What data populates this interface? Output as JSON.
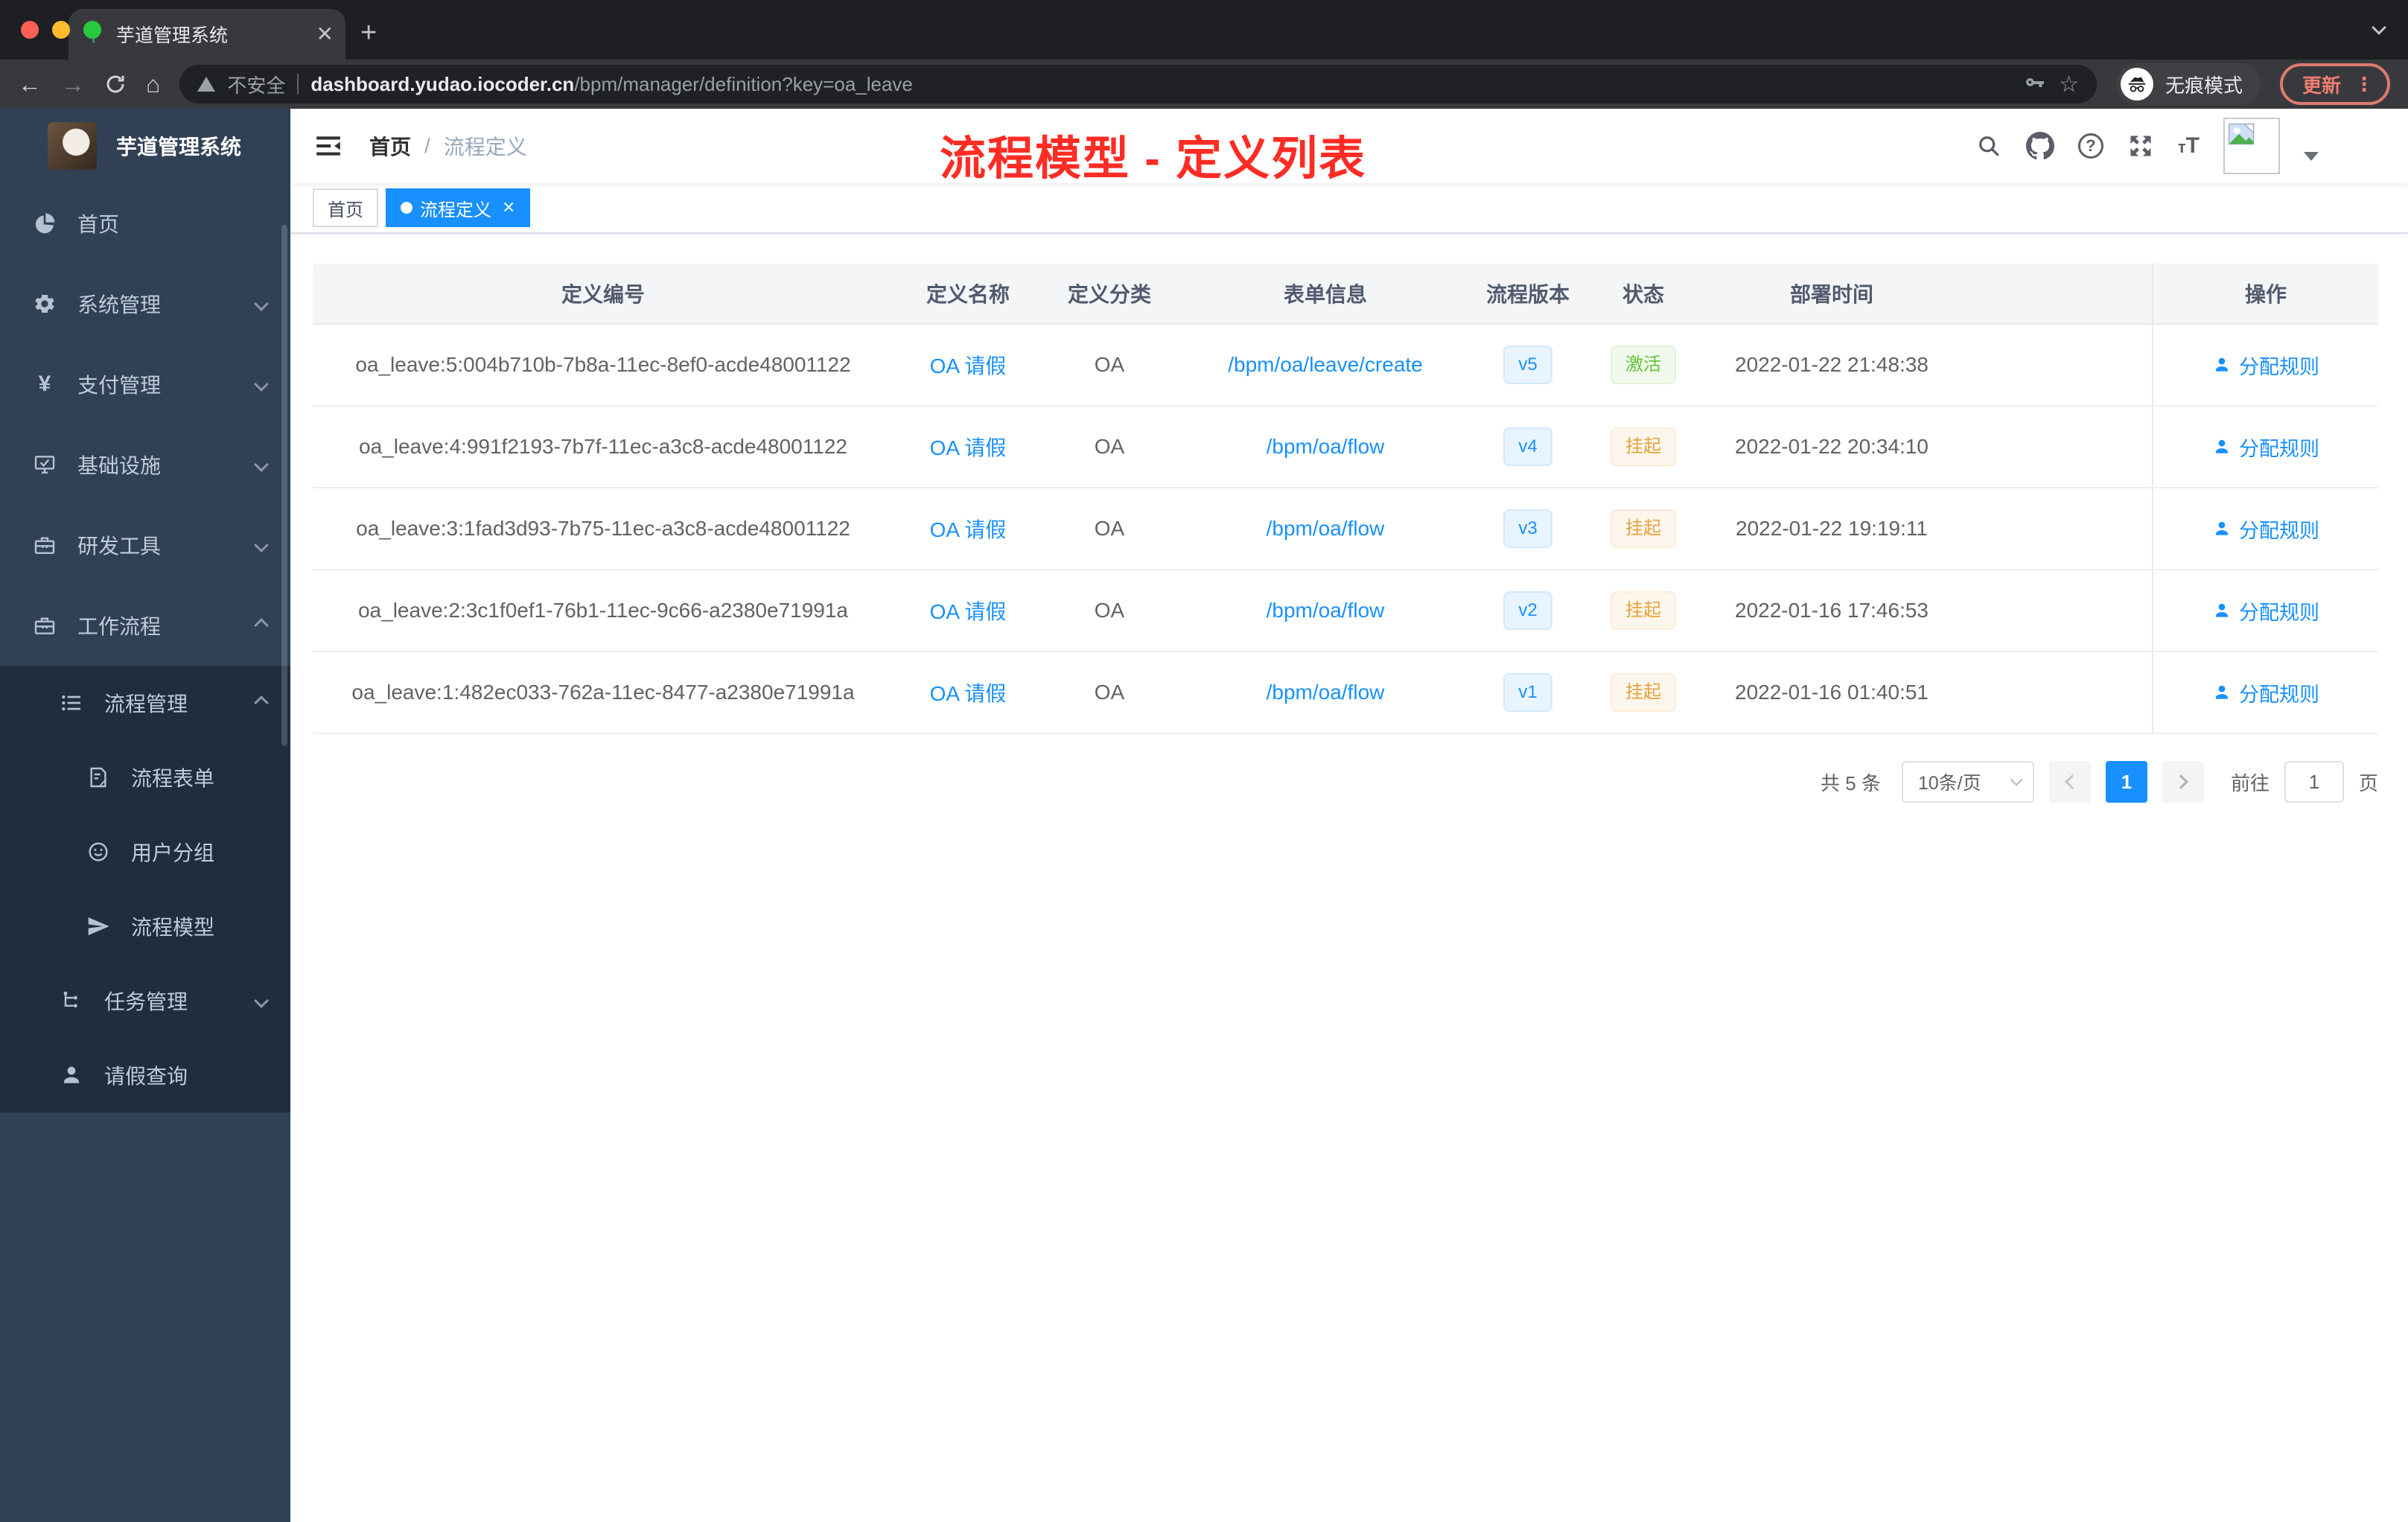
{
  "colors": {
    "accent": "#1890ff",
    "success": "#67c23a",
    "warning": "#e6a23c",
    "annotation_red": "#fe2c25"
  },
  "browser": {
    "tab_title": "芋道管理系统",
    "security_label": "不安全",
    "url_host": "dashboard.yudao.iocoder.cn",
    "url_path": "/bpm/manager/definition?key=oa_leave",
    "incognito_label": "无痕模式",
    "update_label": "更新"
  },
  "sidebar": {
    "app_title": "芋道管理系统",
    "items": [
      {
        "label": "首页"
      },
      {
        "label": "系统管理"
      },
      {
        "label": "支付管理"
      },
      {
        "label": "基础设施"
      },
      {
        "label": "研发工具"
      },
      {
        "label": "工作流程"
      },
      {
        "label": "流程管理"
      },
      {
        "label": "流程表单"
      },
      {
        "label": "用户分组"
      },
      {
        "label": "流程模型"
      },
      {
        "label": "任务管理"
      },
      {
        "label": "请假查询"
      }
    ]
  },
  "header": {
    "breadcrumb_home": "首页",
    "breadcrumb_sep": "/",
    "breadcrumb_current": "流程定义",
    "annotation": "流程模型 - 定义列表"
  },
  "tags": {
    "home": "首页",
    "active": "流程定义"
  },
  "table": {
    "columns": {
      "id": "定义编号",
      "name": "定义名称",
      "category": "定义分类",
      "form": "表单信息",
      "version": "流程版本",
      "status": "状态",
      "deploy_time": "部署时间",
      "actions": "操作"
    },
    "rows": [
      {
        "id": "oa_leave:5:004b710b-7b8a-11ec-8ef0-acde48001122",
        "name": "OA 请假",
        "category": "OA",
        "form": "/bpm/oa/leave/create",
        "version": "v5",
        "status": "激活",
        "time": "2022-01-22 21:48:38",
        "action": "分配规则"
      },
      {
        "id": "oa_leave:4:991f2193-7b7f-11ec-a3c8-acde48001122",
        "name": "OA 请假",
        "category": "OA",
        "form": "/bpm/oa/flow",
        "version": "v4",
        "status": "挂起",
        "time": "2022-01-22 20:34:10",
        "action": "分配规则"
      },
      {
        "id": "oa_leave:3:1fad3d93-7b75-11ec-a3c8-acde48001122",
        "name": "OA 请假",
        "category": "OA",
        "form": "/bpm/oa/flow",
        "version": "v3",
        "status": "挂起",
        "time": "2022-01-22 19:19:11",
        "action": "分配规则"
      },
      {
        "id": "oa_leave:2:3c1f0ef1-76b1-11ec-9c66-a2380e71991a",
        "name": "OA 请假",
        "category": "OA",
        "form": "/bpm/oa/flow",
        "version": "v2",
        "status": "挂起",
        "time": "2022-01-16 17:46:53",
        "action": "分配规则"
      },
      {
        "id": "oa_leave:1:482ec033-762a-11ec-8477-a2380e71991a",
        "name": "OA 请假",
        "category": "OA",
        "form": "/bpm/oa/flow",
        "version": "v1",
        "status": "挂起",
        "time": "2022-01-16 01:40:51",
        "action": "分配规则"
      }
    ]
  },
  "pagination": {
    "total": "共 5 条",
    "page_size": "10条/页",
    "current_page": "1",
    "goto_label": "前往",
    "goto_value": "1",
    "goto_suffix": "页"
  }
}
